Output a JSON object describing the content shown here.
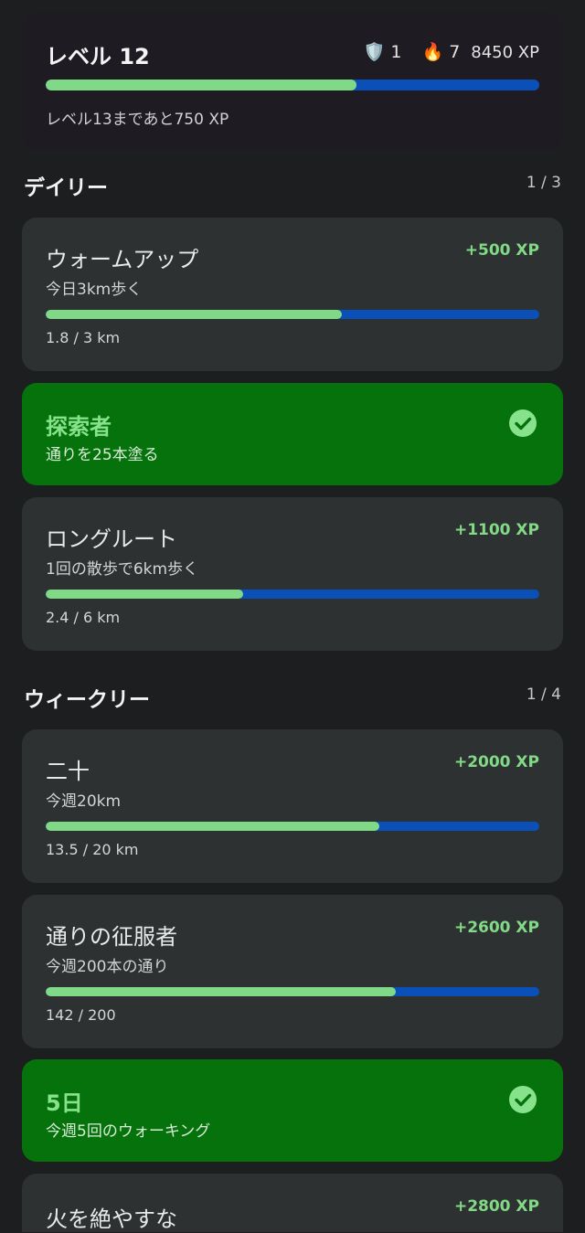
{
  "level": {
    "title": "レベル 12",
    "shields": "1",
    "streak": "7",
    "xp": "8450 XP",
    "progress": 0.63,
    "remaining_text": "レベル13まであと750 XP"
  },
  "daily": {
    "title": "デイリー",
    "count": "1 / 3",
    "quests": [
      {
        "title": "ウォームアップ",
        "desc": "今日3km歩く",
        "xp": "+500 XP",
        "progress_text": "1.8 / 3 km",
        "progress": 0.6
      },
      {
        "title": "探索者",
        "desc": "通りを25本塗る",
        "completed": true
      },
      {
        "title": "ロングルート",
        "desc": "1回の散歩で6km歩く",
        "xp": "+1100 XP",
        "progress_text": "2.4 / 6 km",
        "progress": 0.4
      }
    ]
  },
  "weekly": {
    "title": "ウィークリー",
    "count": "1 / 4",
    "quests": [
      {
        "title": "二十",
        "desc": "今週20km",
        "xp": "+2000 XP",
        "progress_text": "13.5 / 20 km",
        "progress": 0.675
      },
      {
        "title": "通りの征服者",
        "desc": "今週200本の通り",
        "xp": "+2600 XP",
        "progress_text": "142 / 200",
        "progress": 0.71
      },
      {
        "title": "5日",
        "desc": "今週5回のウォーキング",
        "completed": true
      },
      {
        "title": "火を絶やすな",
        "xp": "+2800 XP"
      }
    ]
  },
  "icons": {
    "shield": "shield-icon",
    "flame": "flame-icon",
    "check": "check-circle-icon"
  },
  "colors": {
    "bar_fill": "#7fd986",
    "bar_track": "#0b4fb8",
    "completed_card": "#06720c",
    "xp_reward": "#82d986"
  }
}
